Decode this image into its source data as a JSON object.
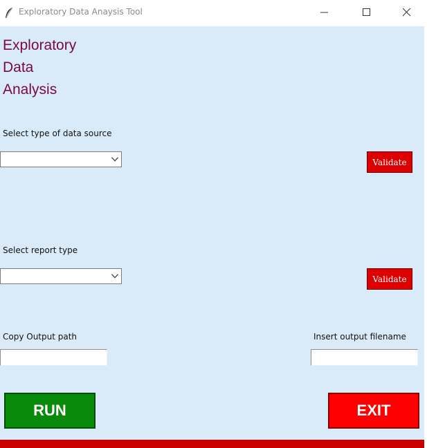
{
  "window": {
    "title": "Exploratory Data Anaysis Tool",
    "icons": {
      "app": "feather-icon",
      "minimize": "minimize-icon",
      "maximize": "maximize-icon",
      "close": "close-icon"
    }
  },
  "heading": {
    "line1": "Exploratory",
    "line2": "Data",
    "line3": "Analysis"
  },
  "data_source": {
    "label": "Select type of data source",
    "selected": "",
    "validate_label": "Validate"
  },
  "report": {
    "label": "Select report type",
    "selected": "",
    "validate_label": "Validate"
  },
  "output_path": {
    "label": "Copy Output path",
    "value": ""
  },
  "output_filename": {
    "label": "Insert output filename",
    "value": ""
  },
  "actions": {
    "run_label": "RUN",
    "exit_label": "EXIT"
  },
  "colors": {
    "background": "#d9eaf8",
    "heading": "#7a0a3c",
    "validate": "#dd0000",
    "run": "#0a8a0a",
    "exit": "#ff0000",
    "footer_bar": "#c80000"
  }
}
